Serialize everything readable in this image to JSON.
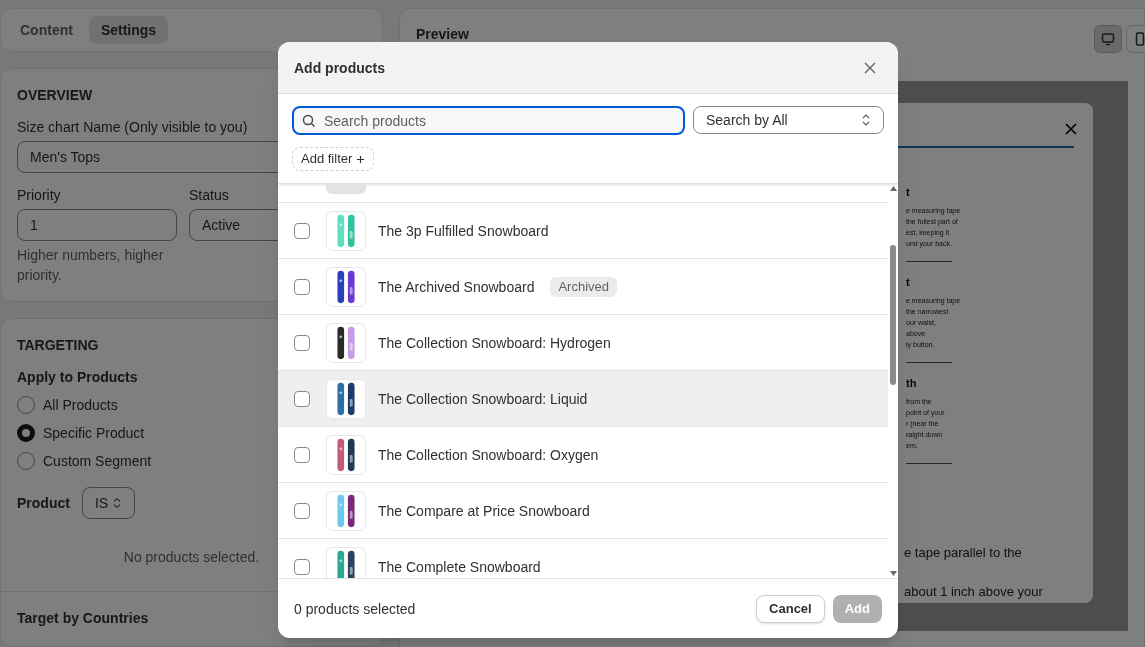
{
  "tabs": [
    {
      "label": "Content",
      "selected": false
    },
    {
      "label": "Settings",
      "selected": true
    }
  ],
  "overview": {
    "heading": "OVERVIEW",
    "name_label": "Size chart Name (Only visible to you)",
    "name_value": "Men's Tops",
    "priority_label": "Priority",
    "priority_value": "1",
    "status_label": "Status",
    "status_value": "Active",
    "priority_help": "Higher numbers, higher priority."
  },
  "targeting": {
    "heading": "TARGETING",
    "apply_label": "Apply to Products",
    "options": [
      {
        "label": "All Products",
        "selected": false
      },
      {
        "label": "Specific Product",
        "selected": true
      },
      {
        "label": "Custom Segment",
        "selected": false
      }
    ],
    "product_label": "Product",
    "operator": "IS",
    "empty_text": "No products selected.",
    "countries_heading": "Target by Countries"
  },
  "preview": {
    "title": "Preview",
    "devices": [
      {
        "kind": "desktop",
        "selected": true
      },
      {
        "kind": "mobile",
        "selected": false
      }
    ],
    "sections": [
      {
        "heading": "t",
        "lines": [
          "e measuring tape",
          "the fullest part of",
          "est, keeping it",
          "und your back."
        ]
      },
      {
        "heading": "t",
        "lines": [
          "e measuring tape",
          "the narrowest",
          "our waist,",
          "above",
          "ly button."
        ]
      },
      {
        "heading": "th",
        "lines": [
          "from the",
          "point of your",
          "r (near the",
          "raight down",
          "em."
        ]
      }
    ],
    "body_lines": [
      "e tape parallel to the",
      "about 1 inch above your"
    ]
  },
  "dialog": {
    "title": "Add products",
    "search": {
      "placeholder": "Search products"
    },
    "search_by": "Search by All",
    "add_filter": "Add filter",
    "products": [
      {
        "name": "The 3p Fulfilled Snowboard",
        "checked": false,
        "hovered": false
      },
      {
        "name": "The Archived Snowboard",
        "badge": "Archived",
        "checked": false,
        "hovered": false
      },
      {
        "name": "The Collection Snowboard: Hydrogen",
        "checked": false,
        "hovered": false
      },
      {
        "name": "The Collection Snowboard: Liquid",
        "checked": false,
        "hovered": true
      },
      {
        "name": "The Collection Snowboard: Oxygen",
        "checked": false,
        "hovered": false
      },
      {
        "name": "The Compare at Price Snowboard",
        "checked": false,
        "hovered": false
      },
      {
        "name": "The Complete Snowboard",
        "checked": false,
        "hovered": false
      }
    ],
    "footer": {
      "count": "0 products selected",
      "cancel": "Cancel",
      "add": "Add",
      "add_disabled": true
    }
  }
}
